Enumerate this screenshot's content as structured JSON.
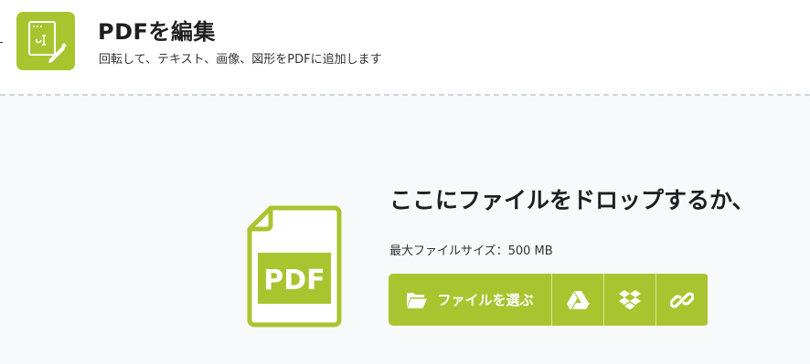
{
  "header": {
    "title": "PDFを編集",
    "subtitle": "回転して、テキスト、画像、図形をPDFに追加します",
    "icon": "pdf-edit-icon"
  },
  "dropzone": {
    "heading": "ここにファイルをドロップするか、",
    "max_size": "最大ファイルサイズ：500 MB",
    "file_icon_label": "PDF",
    "choose_file_label": "ファイルを選ぶ",
    "icons": {
      "choose": "folder-open-icon",
      "google_drive": "google-drive-icon",
      "dropbox": "dropbox-icon",
      "url": "link-icon"
    }
  },
  "colors": {
    "accent": "#a8c52f",
    "background": "#f7f9fb",
    "divider": "#cfd6df"
  }
}
